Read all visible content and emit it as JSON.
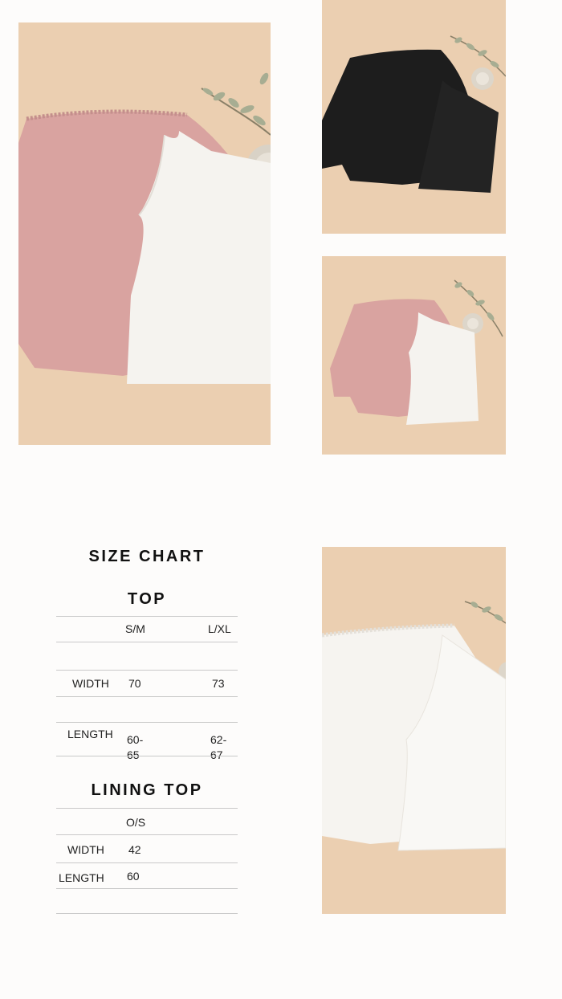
{
  "size_chart": {
    "title": "SIZE CHART",
    "top": {
      "title": "TOP",
      "headers": [
        "S/M",
        "L/XL"
      ],
      "rows": [
        {
          "label": "WIDTH",
          "values": [
            "70",
            "73"
          ]
        },
        {
          "label": "LENGTH",
          "values": [
            "60-65",
            "62-67"
          ]
        }
      ]
    },
    "lining_top": {
      "title": "LINING TOP",
      "headers": [
        "O/S"
      ],
      "rows": [
        {
          "label": "WIDTH",
          "values": [
            "42"
          ]
        },
        {
          "label": "LENGTH",
          "values": [
            "60"
          ]
        }
      ]
    }
  },
  "colors": {
    "background": "#fdfcfb",
    "photo_backdrop": "#e9cdaf",
    "pink_garment": "#dba3a3",
    "white_garment": "#f4f2ee",
    "black_garment": "#1c1c1c",
    "divider": "#c9c9c9"
  },
  "photos": [
    {
      "subject": "pink-top-and-white-one-shoulder-lining"
    },
    {
      "subject": "black-top-and-black-one-shoulder-lining"
    },
    {
      "subject": "pink-top-and-white-lining-small"
    },
    {
      "subject": "white-top-and-white-lining"
    }
  ]
}
